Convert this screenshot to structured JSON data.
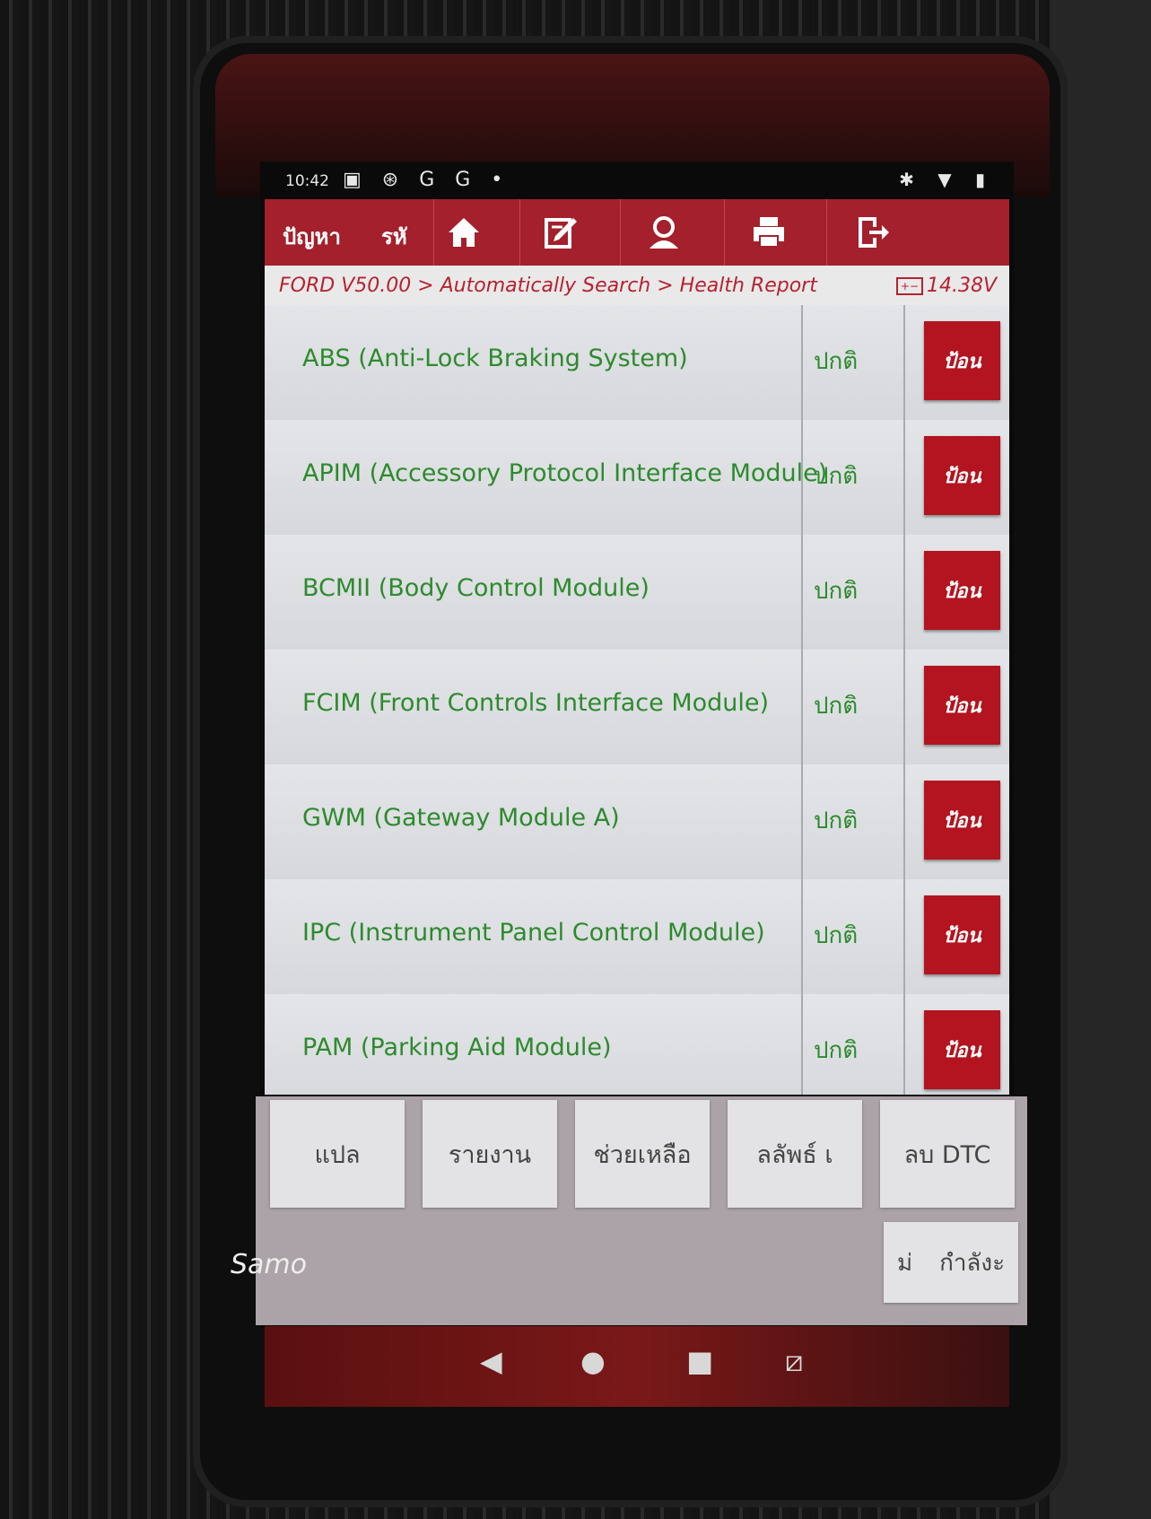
{
  "status_bar": {
    "time": "10:42",
    "left_icons": "▣ ⊛ G G •",
    "right_icons": "✱ ▼ ▮"
  },
  "toolbar": {
    "items": [
      {
        "label": "ปัญหา"
      },
      {
        "label": "รหั"
      }
    ],
    "icons": [
      "home-icon",
      "edit-icon",
      "user-icon",
      "print-icon",
      "exit-icon"
    ]
  },
  "breadcrumb": {
    "path": "FORD V50.00 > Automatically Search > Health Report",
    "voltage": "14.38V",
    "battery_glyph": "+−"
  },
  "modules": [
    {
      "name": "ABS (Anti-Lock Braking System)",
      "status": "ปกติ",
      "action": "ป้อน"
    },
    {
      "name": "APIM (Accessory Protocol Interface Module)",
      "status": "ปกติ",
      "action": "ป้อน"
    },
    {
      "name": "BCMII (Body Control Module)",
      "status": "ปกติ",
      "action": "ป้อน"
    },
    {
      "name": "FCIM (Front Controls Interface Module)",
      "status": "ปกติ",
      "action": "ป้อน"
    },
    {
      "name": "GWM (Gateway Module A)",
      "status": "ปกติ",
      "action": "ป้อน"
    },
    {
      "name": "IPC (Instrument Panel Control Module)",
      "status": "ปกติ",
      "action": "ป้อน"
    },
    {
      "name": "PAM (Parking Aid Module)",
      "status": "ปกติ",
      "action": "ป้อน"
    }
  ],
  "actions": {
    "buttons": [
      "แปล",
      "รายงาน",
      "ช่วยเหลือ",
      "ลลัพธ์ เ",
      "ลบ DTC"
    ],
    "second_row_left": "ม่",
    "second_row_right": "กำลังะ",
    "watermark": "Samo"
  },
  "navbar": {
    "back": "◀",
    "home": "●",
    "recent": "■",
    "screenshot": "⧄"
  }
}
